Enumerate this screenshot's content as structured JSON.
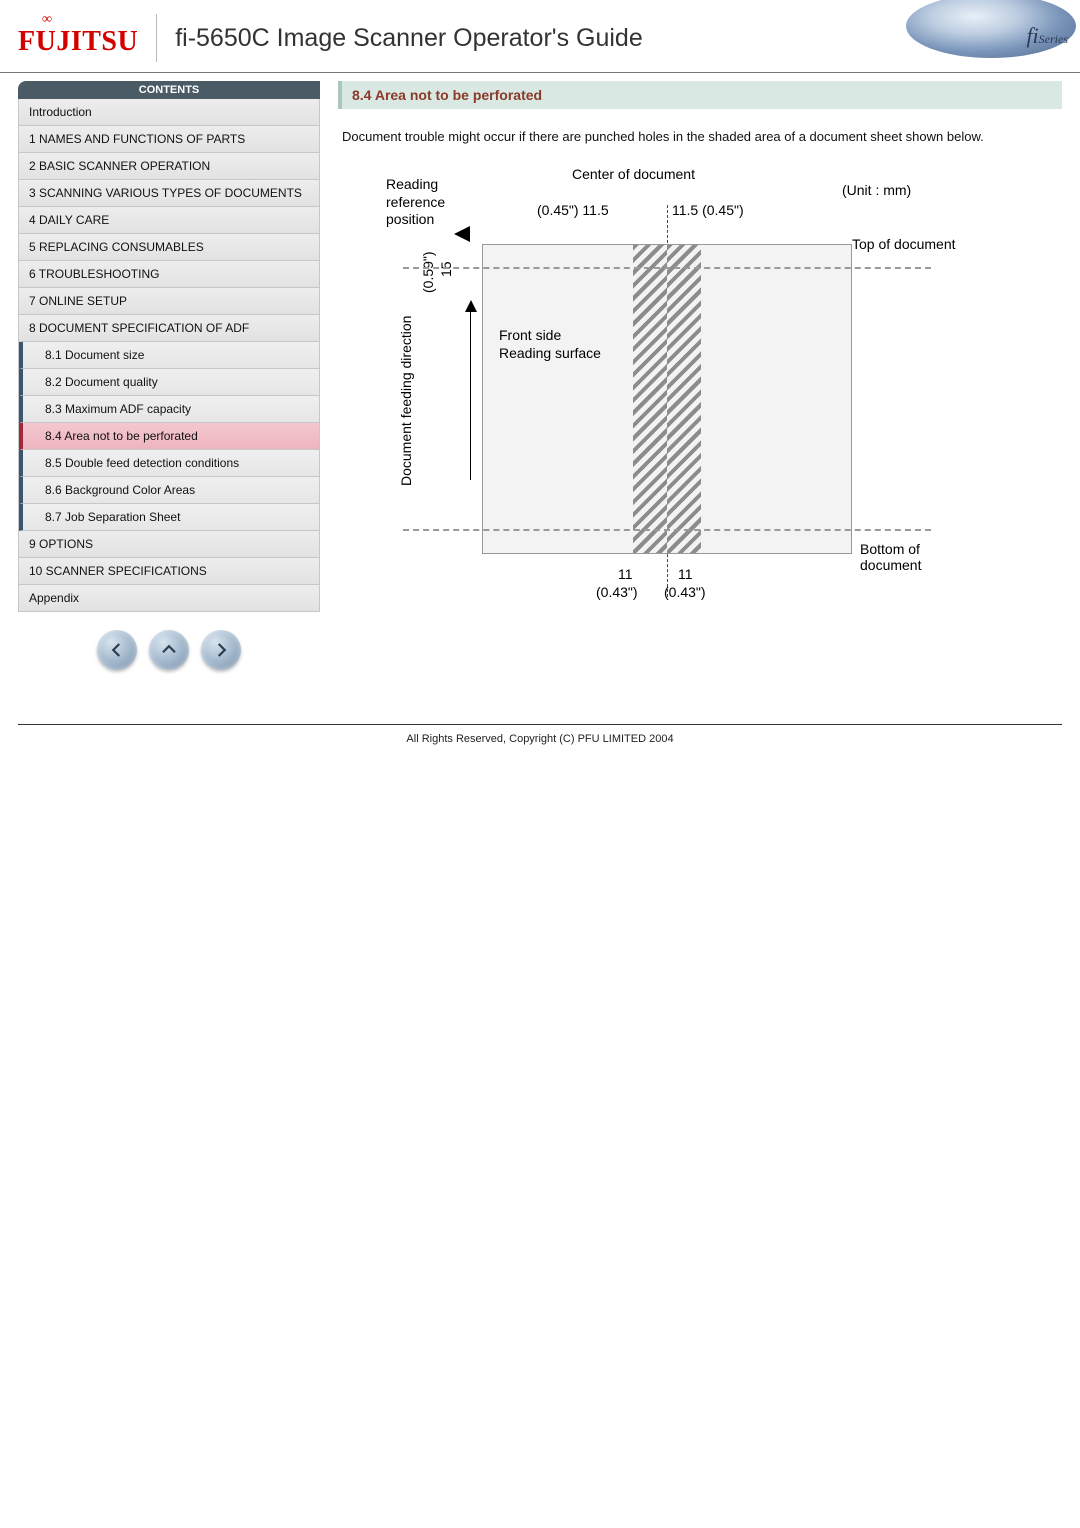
{
  "header": {
    "brand": "FUJITSU",
    "title": "fi-5650C Image Scanner Operator's Guide",
    "series_badge": "fi",
    "series_badge_sub": "Series"
  },
  "sidebar": {
    "header": "CONTENTS",
    "items": [
      {
        "label": "Introduction"
      },
      {
        "label": "1 NAMES AND FUNCTIONS OF PARTS"
      },
      {
        "label": "2 BASIC SCANNER OPERATION"
      },
      {
        "label": "3 SCANNING VARIOUS TYPES OF DOCUMENTS"
      },
      {
        "label": "4 DAILY CARE"
      },
      {
        "label": "5 REPLACING CONSUMABLES"
      },
      {
        "label": "6 TROUBLESHOOTING"
      },
      {
        "label": "7 ONLINE SETUP"
      },
      {
        "label": "8 DOCUMENT SPECIFICATION OF ADF"
      }
    ],
    "subitems": [
      {
        "label": "8.1 Document size"
      },
      {
        "label": "8.2 Document quality"
      },
      {
        "label": "8.3 Maximum ADF capacity"
      },
      {
        "label": "8.4 Area not to be perforated",
        "active": true
      },
      {
        "label": "8.5 Double feed detection conditions"
      },
      {
        "label": "8.6 Background Color Areas"
      },
      {
        "label": "8.7 Job Separation Sheet"
      }
    ],
    "items_after": [
      {
        "label": "9 OPTIONS"
      },
      {
        "label": "10 SCANNER SPECIFICATIONS"
      },
      {
        "label": "Appendix"
      }
    ]
  },
  "content": {
    "heading": "8.4 Area not to be perforated",
    "paragraph": "Document trouble might occur if there are punched holes in the shaded area of a document sheet shown below."
  },
  "diagram": {
    "center_label": "Center of document",
    "unit_label": "(Unit : mm)",
    "reading_ref_line1": "Reading",
    "reading_ref_line2": "reference",
    "reading_ref_line3": "position",
    "top_dim_left": "(0.45\") 11.5",
    "top_dim_right": "11.5 (0.45\")",
    "left_dim_mm": "15",
    "left_dim_in": "(0.59\")",
    "feed_dir_label": "Document feeding direction",
    "front_line1": "Front side",
    "front_line2": "Reading surface",
    "top_of_doc": "Top of document",
    "bottom_of_doc": "Bottom of document",
    "bottom_dim_left_mm": "11",
    "bottom_dim_right_mm": "11",
    "bottom_dim_left_in": "(0.43\")",
    "bottom_dim_right_in": "(0.43\")"
  },
  "footer": {
    "copyright": "All Rights Reserved, Copyright (C) PFU LIMITED 2004"
  }
}
